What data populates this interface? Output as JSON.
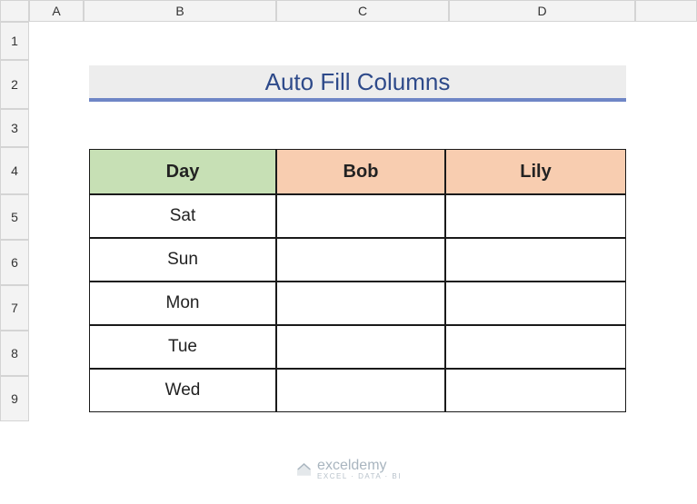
{
  "columns": [
    "A",
    "B",
    "C",
    "D"
  ],
  "rows": [
    "1",
    "2",
    "3",
    "4",
    "5",
    "6",
    "7",
    "8",
    "9"
  ],
  "title": "Auto Fill Columns",
  "table": {
    "headers": [
      "Day",
      "Bob",
      "Lily"
    ],
    "data": [
      [
        "Sat",
        "",
        ""
      ],
      [
        "Sun",
        "",
        ""
      ],
      [
        "Mon",
        "",
        ""
      ],
      [
        "Tue",
        "",
        ""
      ],
      [
        "Wed",
        "",
        ""
      ]
    ]
  },
  "watermark": {
    "brand": "exceldemy",
    "tagline": "EXCEL · DATA · BI"
  },
  "colors": {
    "title_bg": "#ededed",
    "title_underline": "#6f86c6",
    "title_text": "#2e4a8a",
    "header_day": "#c7e0b5",
    "header_name": "#f8cdb0",
    "grid_header": "#f3f3f3"
  }
}
